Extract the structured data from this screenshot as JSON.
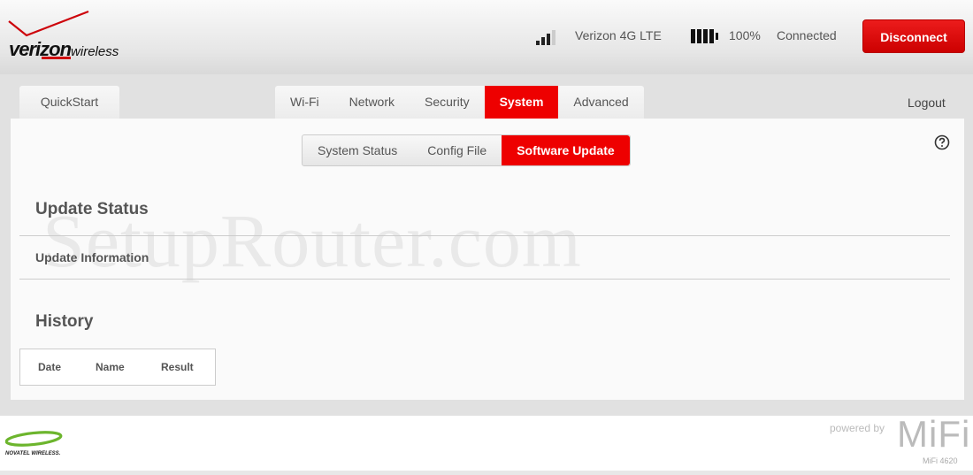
{
  "header": {
    "brand_main": "veri",
    "brand_z": "zon",
    "brand_sub": "wireless",
    "carrier": "Verizon 4G LTE",
    "battery_percent": "100%",
    "connection_status": "Connected",
    "disconnect_label": "Disconnect"
  },
  "nav": {
    "quickstart": "QuickStart",
    "tabs": [
      {
        "label": "Wi-Fi"
      },
      {
        "label": "Network"
      },
      {
        "label": "Security"
      },
      {
        "label": "System"
      },
      {
        "label": "Advanced"
      }
    ],
    "active_tab": "System",
    "logout": "Logout"
  },
  "subnav": {
    "tabs": [
      {
        "label": "System Status"
      },
      {
        "label": "Config File"
      },
      {
        "label": "Software Update"
      }
    ],
    "active_tab": "Software Update"
  },
  "main": {
    "update_status_heading": "Update Status",
    "update_information": "Update Information",
    "history_heading": "History",
    "history_columns": [
      "Date",
      "Name",
      "Result"
    ]
  },
  "watermark": "SetupRouter.com",
  "footer": {
    "novatel_label": "NOVATEL WIRELESS.",
    "powered_by": "powered by",
    "mifi_brand": "MiFi",
    "model": "MiFi 4620"
  },
  "colors": {
    "accent_red": "#e00000",
    "panel_gray": "#e1e1e1"
  }
}
